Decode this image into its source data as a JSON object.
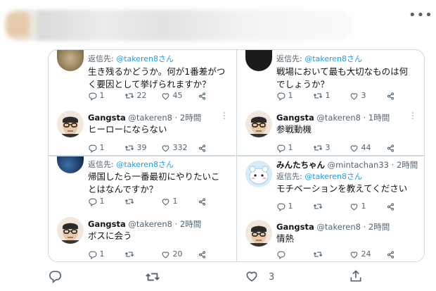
{
  "cards": [
    {
      "parent": {
        "reply_prefix": "返信先: ",
        "reply_handle": "@takeren8さん",
        "text": "生き残るかどうか。何が1番差がつく要因として挙げられますか？",
        "counts": {
          "reply": "1",
          "retweet": "22",
          "like": "45"
        }
      },
      "reply": {
        "name": "Gangsta",
        "meta": "@takeren8 · 2時間",
        "text": "ヒーローにならない",
        "counts": {
          "reply": "1",
          "retweet": "39",
          "like": "332"
        }
      }
    },
    {
      "parent": {
        "reply_prefix": "返信先: ",
        "reply_handle": "@takeren8さん",
        "text": "戦場において最も大切なものは何でしょうか？",
        "counts": {
          "reply": "1",
          "retweet": "1",
          "like": "3"
        }
      },
      "reply": {
        "name": "Gangsta",
        "meta": "@takeren8 · 1時間",
        "text": "参戦動機",
        "counts": {
          "reply": "1",
          "retweet": "3",
          "like": "44"
        }
      }
    },
    {
      "parent": {
        "reply_prefix": "返信先: ",
        "reply_handle": "@takeren8さん",
        "text": "帰国したら一番最初にやりたいことはなんですか？",
        "counts": {
          "reply": "1",
          "retweet": "",
          "like": "1"
        }
      },
      "reply": {
        "name": "Gangsta",
        "meta": "@takeren8 · 2時間",
        "text": "ボスに会う",
        "counts": {
          "reply": "1",
          "retweet": "",
          "like": "20"
        }
      }
    },
    {
      "parent": {
        "name": "みんたちゃん",
        "meta": "@mintachan33 · 2時間",
        "reply_prefix": "返信先: ",
        "reply_handle": "@takeren8さん",
        "text": "モチベーションを教えてください",
        "counts": {
          "reply": "1",
          "retweet": "",
          "like": "1"
        }
      },
      "reply": {
        "name": "Gangsta",
        "meta": "@takeren8 · 2時間",
        "text": "情熱",
        "counts": {
          "reply": "",
          "retweet": "",
          "like": "24"
        }
      }
    }
  ],
  "footer": {
    "like_count": "3"
  },
  "colors": {
    "accent": "#1d9bf0",
    "muted": "#536471",
    "border": "#cfd9de"
  }
}
